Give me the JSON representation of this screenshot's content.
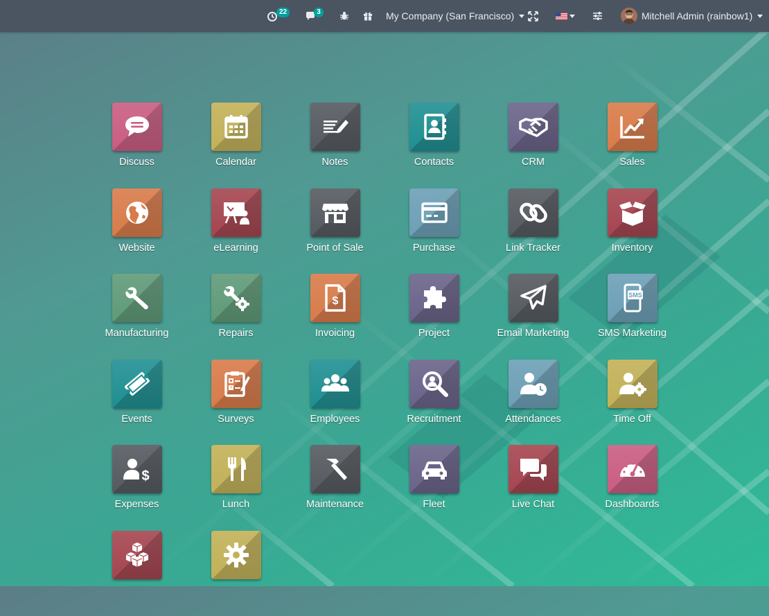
{
  "topbar": {
    "activity_count": "22",
    "messages_count": "3",
    "company": "My Company (San Francisco)",
    "user": "Mitchell Admin (rainbow1)",
    "icons": [
      "activity-clock-icon",
      "chat-icon",
      "bug-icon",
      "gift-icon",
      "fullscreen-icon",
      "us-flag-icon",
      "sliders-icon"
    ]
  },
  "apps": [
    {
      "label": "Discuss",
      "color": "#c95d81",
      "icon": "chat-bubble-icon"
    },
    {
      "label": "Calendar",
      "color": "#c2b158",
      "icon": "calendar-icon"
    },
    {
      "label": "Notes",
      "color": "#555a60",
      "icon": "notes-icon"
    },
    {
      "label": "Contacts",
      "color": "#1f8f92",
      "icon": "address-book-icon"
    },
    {
      "label": "CRM",
      "color": "#6a6389",
      "icon": "handshake-icon"
    },
    {
      "label": "Sales",
      "color": "#d87b4a",
      "icon": "trending-up-icon"
    },
    {
      "label": "Website",
      "color": "#d87b4a",
      "icon": "globe-icon"
    },
    {
      "label": "eLearning",
      "color": "#a54550",
      "icon": "presentation-icon"
    },
    {
      "label": "Point of Sale",
      "color": "#555a60",
      "icon": "store-icon"
    },
    {
      "label": "Purchase",
      "color": "#6c9fb6",
      "icon": "credit-card-icon"
    },
    {
      "label": "Link Tracker",
      "color": "#555a60",
      "icon": "link-icon"
    },
    {
      "label": "Inventory",
      "color": "#a54550",
      "icon": "box-icon"
    },
    {
      "label": "Manufacturing",
      "color": "#5f9a78",
      "icon": "wrench-icon"
    },
    {
      "label": "Repairs",
      "color": "#5f9a78",
      "icon": "wrench-gear-icon"
    },
    {
      "label": "Invoicing",
      "color": "#d87b4a",
      "icon": "invoice-icon"
    },
    {
      "label": "Project",
      "color": "#6a6389",
      "icon": "puzzle-icon"
    },
    {
      "label": "Email Marketing",
      "color": "#555a60",
      "icon": "paper-plane-icon"
    },
    {
      "label": "SMS Marketing",
      "color": "#6c9fb6",
      "icon": "sms-phone-icon"
    },
    {
      "label": "Events",
      "color": "#1f8f92",
      "icon": "ticket-icon"
    },
    {
      "label": "Surveys",
      "color": "#d87b4a",
      "icon": "clipboard-icon"
    },
    {
      "label": "Employees",
      "color": "#1f8f92",
      "icon": "users-icon"
    },
    {
      "label": "Recruitment",
      "color": "#6a6389",
      "icon": "magnifier-icon"
    },
    {
      "label": "Attendances",
      "color": "#6c9fb6",
      "icon": "user-clock-icon"
    },
    {
      "label": "Time Off",
      "color": "#c2b158",
      "icon": "user-gear-icon"
    },
    {
      "label": "Expenses",
      "color": "#555a60",
      "icon": "user-dollar-icon"
    },
    {
      "label": "Lunch",
      "color": "#c2b158",
      "icon": "cutlery-icon"
    },
    {
      "label": "Maintenance",
      "color": "#555a60",
      "icon": "hammer-icon"
    },
    {
      "label": "Fleet",
      "color": "#6a6389",
      "icon": "car-icon"
    },
    {
      "label": "Live Chat",
      "color": "#a54550",
      "icon": "chat-bubbles-icon"
    },
    {
      "label": "Dashboards",
      "color": "#c95d81",
      "icon": "gauge-icon"
    },
    {
      "label": "",
      "color": "#a54550",
      "icon": "cubes-icon"
    },
    {
      "label": "",
      "color": "#c2b158",
      "icon": "settings-gear-icon"
    }
  ]
}
